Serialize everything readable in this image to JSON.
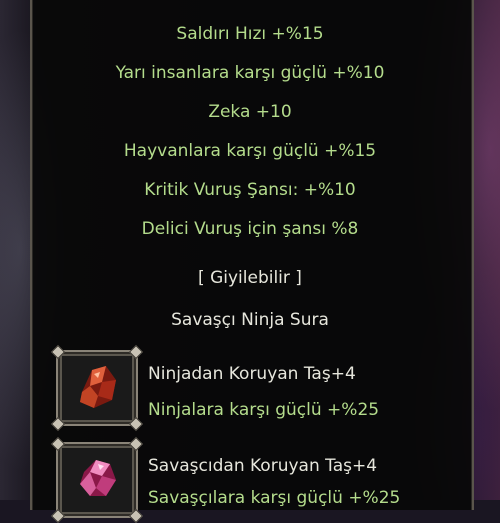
{
  "tooltip": {
    "stats": [
      "Saldırı Hızı +%15",
      "Yarı insanlara karşı güçlü +%10",
      "Zeka +10",
      "Hayvanlara karşı güçlü +%15",
      "Kritik Vuruş Şansı: +%10",
      "Delici Vuruş için şansı %8"
    ],
    "wearable": "[ Giyilebilir ]",
    "classes": "Savaşçı Ninja Sura",
    "stones": [
      {
        "name": "Ninjadan Koruyan Taş+4",
        "bonus": "Ninjalara karşı güçlü +%25",
        "icon": "red-crystal-stone-icon",
        "color": "#c0392b"
      },
      {
        "name": "Savaşcıdan Koruyan Taş+4",
        "bonus": "Savaşçılara karşı güçlü +%25",
        "icon": "pink-crystal-stone-icon",
        "color": "#d0508a"
      }
    ]
  },
  "colors": {
    "bonus_text": "#b4dc8c",
    "normal_text": "#e6e6dc"
  }
}
